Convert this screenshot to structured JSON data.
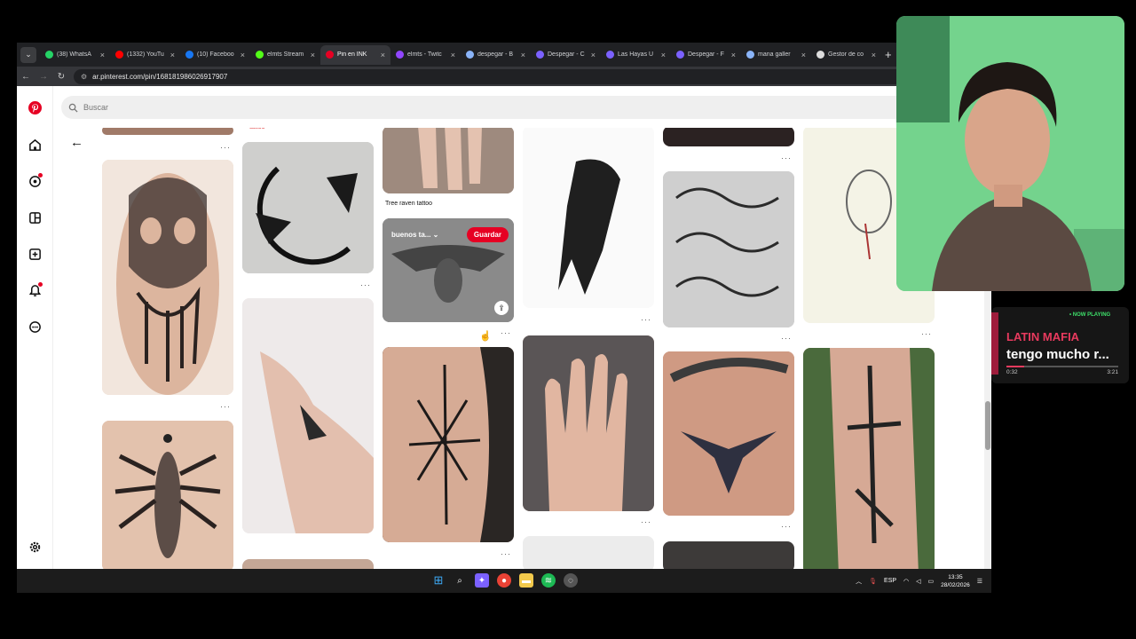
{
  "browser": {
    "tabs": [
      {
        "label": "(38) WhatsA",
        "color": "#25d366"
      },
      {
        "label": "(1332) YouTu",
        "color": "#ff0000"
      },
      {
        "label": "(10) Faceboo",
        "color": "#1877f2"
      },
      {
        "label": "elmts Stream",
        "color": "#53fc18"
      },
      {
        "label": "Pin en INK",
        "color": "#e60023",
        "active": true
      },
      {
        "label": "elmts - Twitc",
        "color": "#9146ff"
      },
      {
        "label": "despegar - B",
        "color": "#8ab4f8"
      },
      {
        "label": "Despegar - C",
        "color": "#7b61ff"
      },
      {
        "label": "Las Hayas U",
        "color": "#7b61ff"
      },
      {
        "label": "Despegar - F",
        "color": "#7b61ff"
      },
      {
        "label": "mana galler",
        "color": "#8ab4f8"
      },
      {
        "label": "Gestor de co",
        "color": "#dddddd"
      }
    ],
    "url": "ar.pinterest.com/pin/168181986026917907"
  },
  "pinterest": {
    "search_placeholder": "Buscar",
    "top_caption": "tattoo",
    "pin_caption": "Tree raven tattoo",
    "board_name": "buenos ta...",
    "save_label": "Guardar",
    "more_label": "···"
  },
  "taskbar": {
    "language": "ESP",
    "time": "13:35",
    "date": "28/02/2026"
  },
  "now_playing": {
    "badge": "• NOW PLAYING",
    "artist": "LATIN MAFIA",
    "title": "tengo mucho r...",
    "current": "0:32",
    "duration": "3:21",
    "progress": 0.16
  },
  "colors": {
    "brand": "#e60023",
    "taskbar": "#1c1c1c",
    "tabbar": "#202124",
    "webcam_bg": "#6fd08a",
    "player_accent": "#e83a5e"
  }
}
